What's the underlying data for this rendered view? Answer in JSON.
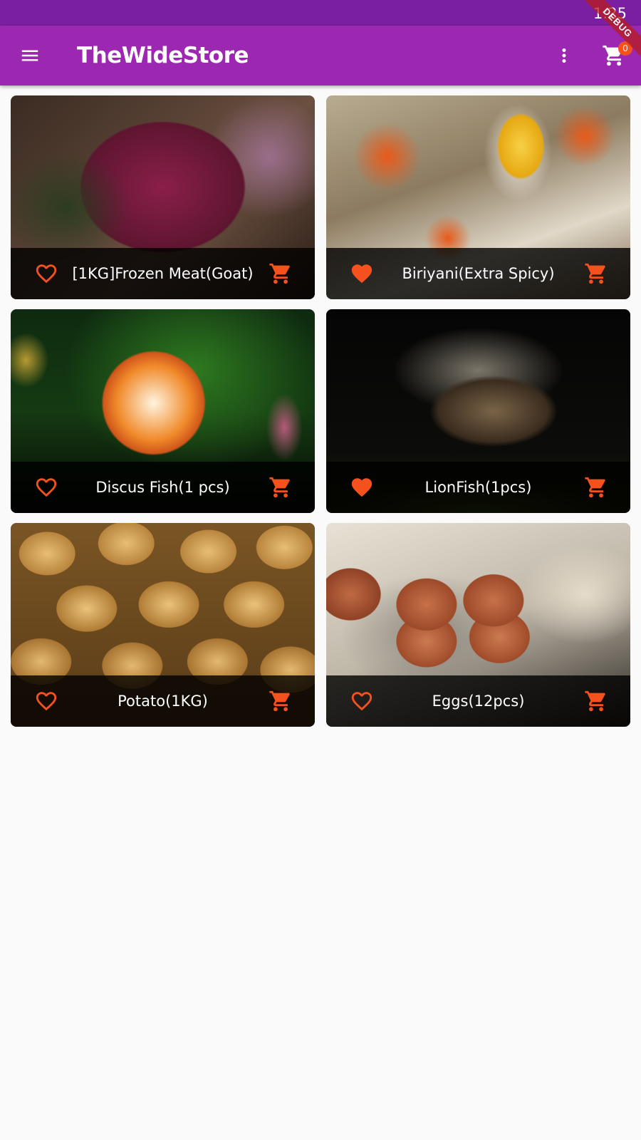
{
  "status_bar": {
    "time": "1:25"
  },
  "app_bar": {
    "title": "TheWideStore",
    "cart_count": "0",
    "debug_label": "DEBUG"
  },
  "colors": {
    "primary": "#9c27b0",
    "primary_dark": "#7b1fa2",
    "accent": "#f4511e"
  },
  "icons": {
    "menu": "menu-icon",
    "more": "more-vert-icon",
    "cart": "shopping-cart-icon",
    "favorite": "heart-icon",
    "add_to_cart": "add-cart-icon"
  },
  "products": [
    {
      "title": "[1KG]Frozen Meat(Goat)",
      "favorited": false,
      "image": "frozen goat meat with rosemary"
    },
    {
      "title": "Biriyani(Extra Spicy)",
      "favorited": true,
      "image": "biriyani rice with egg"
    },
    {
      "title": "Discus Fish(1 pcs)",
      "favorited": false,
      "image": "orange discus fish"
    },
    {
      "title": "LionFish(1pcs)",
      "favorited": true,
      "image": "lionfish on dark background"
    },
    {
      "title": "Potato(1KG)",
      "favorited": false,
      "image": "pile of potatoes"
    },
    {
      "title": "Eggs(12pcs)",
      "favorited": false,
      "image": "brown eggs in carton"
    }
  ]
}
